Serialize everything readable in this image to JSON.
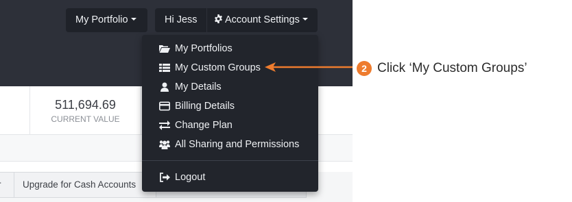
{
  "nav": {
    "portfolio_label": "My Portfolio",
    "greeting": "Hi Jess",
    "account_settings_label": "Account Settings"
  },
  "summary": {
    "value": "511,694.69",
    "label": "CURRENT VALUE"
  },
  "tabs": {
    "left_partial": "r",
    "upgrade": "Upgrade for Cash Accounts"
  },
  "menu": {
    "items": [
      {
        "label": "My Portfolios",
        "icon": "folder-open-icon"
      },
      {
        "label": "My Custom Groups",
        "icon": "list-icon"
      },
      {
        "label": "My Details",
        "icon": "user-icon"
      },
      {
        "label": "Billing Details",
        "icon": "credit-card-icon"
      },
      {
        "label": "Change Plan",
        "icon": "exchange-icon"
      },
      {
        "label": "All Sharing and Permissions",
        "icon": "users-icon"
      },
      {
        "label": "Logout",
        "icon": "sign-out-icon"
      }
    ]
  },
  "callout": {
    "number": "2",
    "text": "Click ‘My Custom Groups’",
    "color": "#ee7c2e"
  }
}
